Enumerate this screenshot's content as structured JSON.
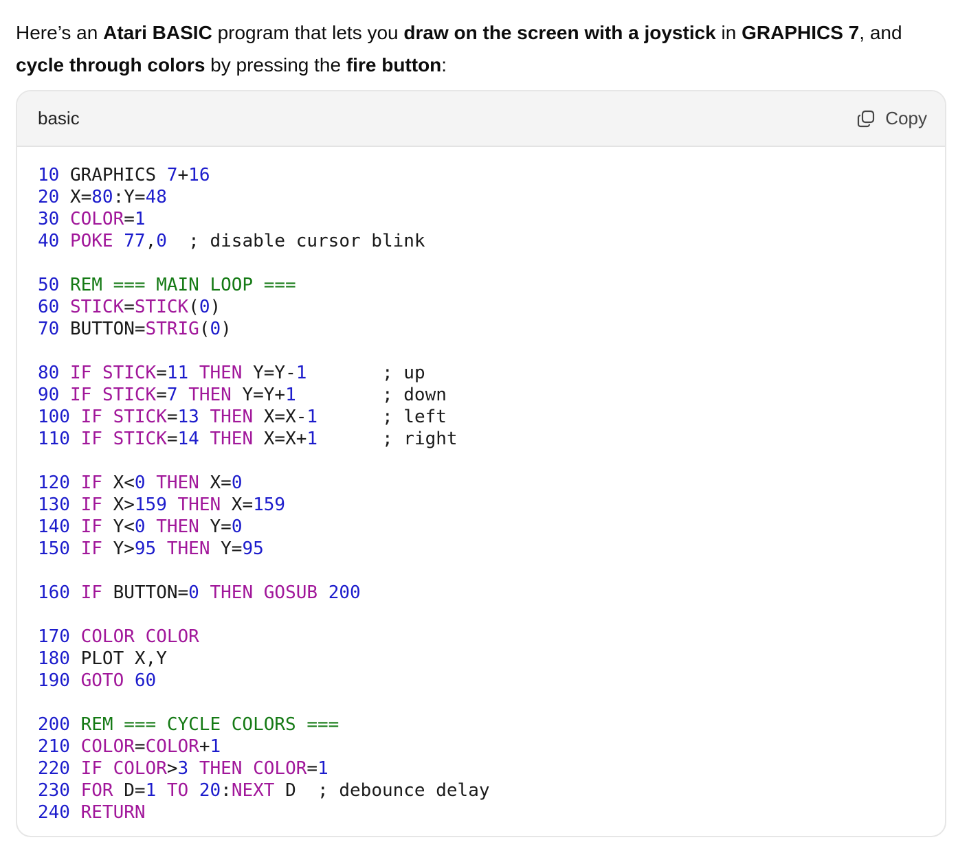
{
  "intro": {
    "p1": "Here’s an ",
    "b1": "Atari BASIC",
    "p2": " program that lets you ",
    "b2": "draw on the screen with a joystick",
    "p3": " in ",
    "b3": "GRAPHICS 7",
    "p4": ", and ",
    "b4": "cycle through colors",
    "p5": " by pressing the ",
    "b5": "fire button",
    "p6": ":"
  },
  "code_block": {
    "language": "basic",
    "copy_label": "Copy",
    "copy_icon": "copy-icon",
    "colors": {
      "number": "#1c1ccc",
      "keyword": "#a1179a",
      "rem": "#157a15",
      "text": "#1a1a1a"
    },
    "lines": [
      [
        {
          "t": "10",
          "c": "num"
        },
        {
          "t": " GRAPHICS ",
          "c": "tx"
        },
        {
          "t": "7",
          "c": "num"
        },
        {
          "t": "+",
          "c": "tx"
        },
        {
          "t": "16",
          "c": "num"
        }
      ],
      [
        {
          "t": "20",
          "c": "num"
        },
        {
          "t": " X=",
          "c": "tx"
        },
        {
          "t": "80",
          "c": "num"
        },
        {
          "t": ":Y=",
          "c": "tx"
        },
        {
          "t": "48",
          "c": "num"
        }
      ],
      [
        {
          "t": "30",
          "c": "num"
        },
        {
          "t": " ",
          "c": "tx"
        },
        {
          "t": "COLOR",
          "c": "kw"
        },
        {
          "t": "=",
          "c": "tx"
        },
        {
          "t": "1",
          "c": "num"
        }
      ],
      [
        {
          "t": "40",
          "c": "num"
        },
        {
          "t": " ",
          "c": "tx"
        },
        {
          "t": "POKE",
          "c": "kw"
        },
        {
          "t": " ",
          "c": "tx"
        },
        {
          "t": "77",
          "c": "num"
        },
        {
          "t": ",",
          "c": "tx"
        },
        {
          "t": "0",
          "c": "num"
        },
        {
          "t": "  ; disable cursor blink",
          "c": "tx"
        }
      ],
      [],
      [
        {
          "t": "50",
          "c": "num"
        },
        {
          "t": " REM === MAIN LOOP ===",
          "c": "cm"
        }
      ],
      [
        {
          "t": "60",
          "c": "num"
        },
        {
          "t": " ",
          "c": "tx"
        },
        {
          "t": "STICK",
          "c": "kw"
        },
        {
          "t": "=",
          "c": "tx"
        },
        {
          "t": "STICK",
          "c": "kw"
        },
        {
          "t": "(",
          "c": "tx"
        },
        {
          "t": "0",
          "c": "num"
        },
        {
          "t": ")",
          "c": "tx"
        }
      ],
      [
        {
          "t": "70",
          "c": "num"
        },
        {
          "t": " BUTTON=",
          "c": "tx"
        },
        {
          "t": "STRIG",
          "c": "kw"
        },
        {
          "t": "(",
          "c": "tx"
        },
        {
          "t": "0",
          "c": "num"
        },
        {
          "t": ")",
          "c": "tx"
        }
      ],
      [],
      [
        {
          "t": "80",
          "c": "num"
        },
        {
          "t": " ",
          "c": "tx"
        },
        {
          "t": "IF",
          "c": "kw"
        },
        {
          "t": " ",
          "c": "tx"
        },
        {
          "t": "STICK",
          "c": "kw"
        },
        {
          "t": "=",
          "c": "tx"
        },
        {
          "t": "11",
          "c": "num"
        },
        {
          "t": " ",
          "c": "tx"
        },
        {
          "t": "THEN",
          "c": "kw"
        },
        {
          "t": " Y=Y-",
          "c": "tx"
        },
        {
          "t": "1",
          "c": "num"
        },
        {
          "t": "       ; up",
          "c": "tx"
        }
      ],
      [
        {
          "t": "90",
          "c": "num"
        },
        {
          "t": " ",
          "c": "tx"
        },
        {
          "t": "IF",
          "c": "kw"
        },
        {
          "t": " ",
          "c": "tx"
        },
        {
          "t": "STICK",
          "c": "kw"
        },
        {
          "t": "=",
          "c": "tx"
        },
        {
          "t": "7",
          "c": "num"
        },
        {
          "t": " ",
          "c": "tx"
        },
        {
          "t": "THEN",
          "c": "kw"
        },
        {
          "t": " Y=Y+",
          "c": "tx"
        },
        {
          "t": "1",
          "c": "num"
        },
        {
          "t": "        ; down",
          "c": "tx"
        }
      ],
      [
        {
          "t": "100",
          "c": "num"
        },
        {
          "t": " ",
          "c": "tx"
        },
        {
          "t": "IF",
          "c": "kw"
        },
        {
          "t": " ",
          "c": "tx"
        },
        {
          "t": "STICK",
          "c": "kw"
        },
        {
          "t": "=",
          "c": "tx"
        },
        {
          "t": "13",
          "c": "num"
        },
        {
          "t": " ",
          "c": "tx"
        },
        {
          "t": "THEN",
          "c": "kw"
        },
        {
          "t": " X=X-",
          "c": "tx"
        },
        {
          "t": "1",
          "c": "num"
        },
        {
          "t": "      ; left",
          "c": "tx"
        }
      ],
      [
        {
          "t": "110",
          "c": "num"
        },
        {
          "t": " ",
          "c": "tx"
        },
        {
          "t": "IF",
          "c": "kw"
        },
        {
          "t": " ",
          "c": "tx"
        },
        {
          "t": "STICK",
          "c": "kw"
        },
        {
          "t": "=",
          "c": "tx"
        },
        {
          "t": "14",
          "c": "num"
        },
        {
          "t": " ",
          "c": "tx"
        },
        {
          "t": "THEN",
          "c": "kw"
        },
        {
          "t": " X=X+",
          "c": "tx"
        },
        {
          "t": "1",
          "c": "num"
        },
        {
          "t": "      ; right",
          "c": "tx"
        }
      ],
      [],
      [
        {
          "t": "120",
          "c": "num"
        },
        {
          "t": " ",
          "c": "tx"
        },
        {
          "t": "IF",
          "c": "kw"
        },
        {
          "t": " X<",
          "c": "tx"
        },
        {
          "t": "0",
          "c": "num"
        },
        {
          "t": " ",
          "c": "tx"
        },
        {
          "t": "THEN",
          "c": "kw"
        },
        {
          "t": " X=",
          "c": "tx"
        },
        {
          "t": "0",
          "c": "num"
        }
      ],
      [
        {
          "t": "130",
          "c": "num"
        },
        {
          "t": " ",
          "c": "tx"
        },
        {
          "t": "IF",
          "c": "kw"
        },
        {
          "t": " X>",
          "c": "tx"
        },
        {
          "t": "159",
          "c": "num"
        },
        {
          "t": " ",
          "c": "tx"
        },
        {
          "t": "THEN",
          "c": "kw"
        },
        {
          "t": " X=",
          "c": "tx"
        },
        {
          "t": "159",
          "c": "num"
        }
      ],
      [
        {
          "t": "140",
          "c": "num"
        },
        {
          "t": " ",
          "c": "tx"
        },
        {
          "t": "IF",
          "c": "kw"
        },
        {
          "t": " Y<",
          "c": "tx"
        },
        {
          "t": "0",
          "c": "num"
        },
        {
          "t": " ",
          "c": "tx"
        },
        {
          "t": "THEN",
          "c": "kw"
        },
        {
          "t": " Y=",
          "c": "tx"
        },
        {
          "t": "0",
          "c": "num"
        }
      ],
      [
        {
          "t": "150",
          "c": "num"
        },
        {
          "t": " ",
          "c": "tx"
        },
        {
          "t": "IF",
          "c": "kw"
        },
        {
          "t": " Y>",
          "c": "tx"
        },
        {
          "t": "95",
          "c": "num"
        },
        {
          "t": " ",
          "c": "tx"
        },
        {
          "t": "THEN",
          "c": "kw"
        },
        {
          "t": " Y=",
          "c": "tx"
        },
        {
          "t": "95",
          "c": "num"
        }
      ],
      [],
      [
        {
          "t": "160",
          "c": "num"
        },
        {
          "t": " ",
          "c": "tx"
        },
        {
          "t": "IF",
          "c": "kw"
        },
        {
          "t": " BUTTON=",
          "c": "tx"
        },
        {
          "t": "0",
          "c": "num"
        },
        {
          "t": " ",
          "c": "tx"
        },
        {
          "t": "THEN",
          "c": "kw"
        },
        {
          "t": " ",
          "c": "tx"
        },
        {
          "t": "GOSUB",
          "c": "kw"
        },
        {
          "t": " ",
          "c": "tx"
        },
        {
          "t": "200",
          "c": "num"
        }
      ],
      [],
      [
        {
          "t": "170",
          "c": "num"
        },
        {
          "t": " ",
          "c": "tx"
        },
        {
          "t": "COLOR",
          "c": "kw"
        },
        {
          "t": " ",
          "c": "tx"
        },
        {
          "t": "COLOR",
          "c": "kw"
        }
      ],
      [
        {
          "t": "180",
          "c": "num"
        },
        {
          "t": " PLOT X,Y",
          "c": "tx"
        }
      ],
      [
        {
          "t": "190",
          "c": "num"
        },
        {
          "t": " ",
          "c": "tx"
        },
        {
          "t": "GOTO",
          "c": "kw"
        },
        {
          "t": " ",
          "c": "tx"
        },
        {
          "t": "60",
          "c": "num"
        }
      ],
      [],
      [
        {
          "t": "200",
          "c": "num"
        },
        {
          "t": " REM === CYCLE COLORS ===",
          "c": "cm"
        }
      ],
      [
        {
          "t": "210",
          "c": "num"
        },
        {
          "t": " ",
          "c": "tx"
        },
        {
          "t": "COLOR",
          "c": "kw"
        },
        {
          "t": "=",
          "c": "tx"
        },
        {
          "t": "COLOR",
          "c": "kw"
        },
        {
          "t": "+",
          "c": "tx"
        },
        {
          "t": "1",
          "c": "num"
        }
      ],
      [
        {
          "t": "220",
          "c": "num"
        },
        {
          "t": " ",
          "c": "tx"
        },
        {
          "t": "IF",
          "c": "kw"
        },
        {
          "t": " ",
          "c": "tx"
        },
        {
          "t": "COLOR",
          "c": "kw"
        },
        {
          "t": ">",
          "c": "tx"
        },
        {
          "t": "3",
          "c": "num"
        },
        {
          "t": " ",
          "c": "tx"
        },
        {
          "t": "THEN",
          "c": "kw"
        },
        {
          "t": " ",
          "c": "tx"
        },
        {
          "t": "COLOR",
          "c": "kw"
        },
        {
          "t": "=",
          "c": "tx"
        },
        {
          "t": "1",
          "c": "num"
        }
      ],
      [
        {
          "t": "230",
          "c": "num"
        },
        {
          "t": " ",
          "c": "tx"
        },
        {
          "t": "FOR",
          "c": "kw"
        },
        {
          "t": " D=",
          "c": "tx"
        },
        {
          "t": "1",
          "c": "num"
        },
        {
          "t": " ",
          "c": "tx"
        },
        {
          "t": "TO",
          "c": "kw"
        },
        {
          "t": " ",
          "c": "tx"
        },
        {
          "t": "20",
          "c": "num"
        },
        {
          "t": ":",
          "c": "tx"
        },
        {
          "t": "NEXT",
          "c": "kw"
        },
        {
          "t": " D  ; debounce delay",
          "c": "tx"
        }
      ],
      [
        {
          "t": "240",
          "c": "num"
        },
        {
          "t": " ",
          "c": "tx"
        },
        {
          "t": "RETURN",
          "c": "kw"
        }
      ]
    ]
  }
}
